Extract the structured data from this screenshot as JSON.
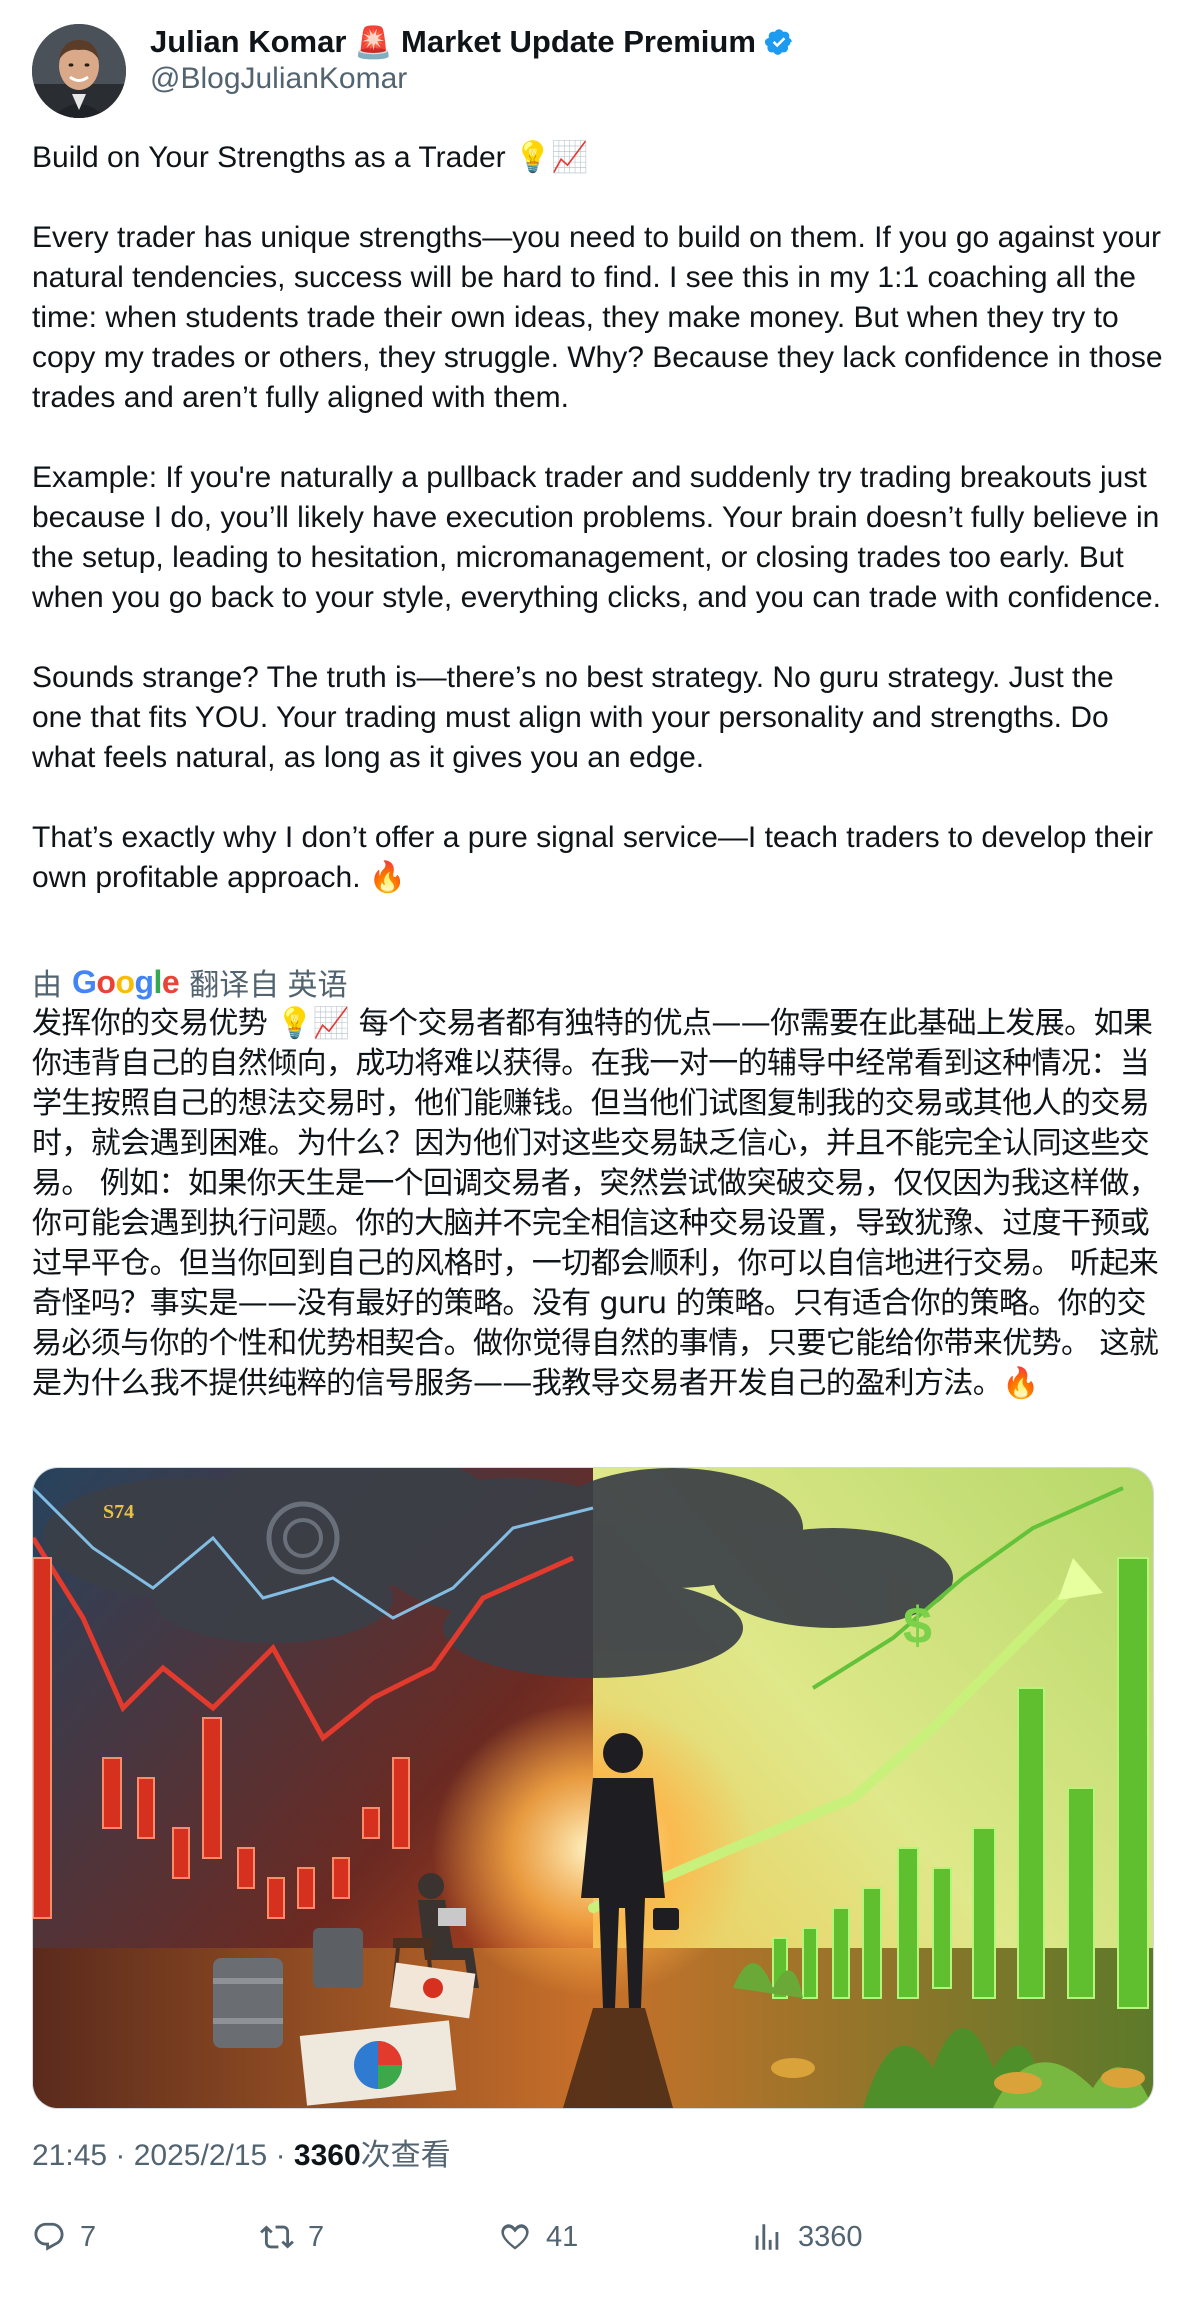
{
  "author": {
    "name": "Julian Komar",
    "badge_emoji": "🚨",
    "name_suffix": "Market Update Premium",
    "handle": "@BlogJulianKomar"
  },
  "post": {
    "text": "Build on Your Strengths as a Trader 💡📈\n\nEvery trader has unique strengths—you need to build on them. If you go against your natural tendencies, success will be hard to find. I see this in my 1:1 coaching all the time: when students trade their own ideas, they make money. But when they try to copy my trades or others, they struggle. Why? Because they lack confidence in those trades and aren’t fully aligned with them.\n\nExample: If you're naturally a pullback trader and suddenly try trading breakouts just because I do, you’ll likely have execution problems. Your brain doesn’t fully believe in the setup, leading to hesitation, micromanagement, or closing trades too early. But when you go back to your style, everything clicks, and you can trade with confidence.\n\nSounds strange? The truth is—there’s no best strategy. No guru strategy. Just the one that fits YOU. Your trading must align with your personality and strengths. Do what feels natural, as long as it gives you an edge.\n\nThat’s exactly why I don’t offer a pure signal service—I teach traders to develop their own profitable approach. 🔥"
  },
  "translation": {
    "prefix": "由",
    "provider": "Google",
    "label": "翻译自 英语",
    "text": "发挥你的交易优势 💡📈 每个交易者都有独特的优点——你需要在此基础上发展。如果你违背自己的自然倾向，成功将难以获得。在我一对一的辅导中经常看到这种情况：当学生按照自己的想法交易时，他们能赚钱。但当他们试图复制我的交易或其他人的交易时，就会遇到困难。为什么？因为他们对这些交易缺乏信心，并且不能完全认同这些交易。 例如：如果你天生是一个回调交易者，突然尝试做突破交易，仅仅因为我这样做，你可能会遇到执行问题。你的大脑并不完全相信这种交易设置，导致犹豫、过度干预或过早平仓。但当你回到自己的风格时，一切都会顺利，你可以自信地进行交易。 听起来奇怪吗？事实是——没有最好的策略。没有 guru 的策略。只有适合你的策略。你的交易必须与你的个性和优势相契合。做你觉得自然的事情，只要它能给你带来优势。 这就是为什么我不提供纯粹的信号服务——我教导交易者开发自己的盈利方法。🔥"
  },
  "image": {
    "sign_text": "S74",
    "dollar_symbol": "$"
  },
  "meta": {
    "time": "21:45",
    "date": "2025/2/15",
    "views": "3360",
    "views_label": "次查看"
  },
  "actions": {
    "replies": "7",
    "reposts": "7",
    "likes": "41",
    "views": "3360"
  },
  "colors": {
    "verified": "#1d9bf0",
    "muted": "#536471",
    "text": "#0f1419"
  }
}
